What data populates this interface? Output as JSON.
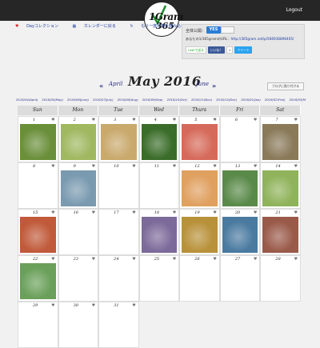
{
  "header": {
    "logout": "Logout"
  },
  "logo": {
    "top": "1Gram",
    "bottom": "365"
  },
  "links": {
    "day_collection": "Dayコレクション",
    "calendar": "カレンダーに戻る",
    "more": "もう一度写真を読み込む"
  },
  "panel": {
    "public_label": "全体公開：",
    "public_value": "YES",
    "url_label": "あなたの1/365gramのURL：",
    "url": "http://365gram.net/p/566936896405/",
    "line_btn": "LINEで送る",
    "fb_btn": "いいね！",
    "fb_count": "0",
    "tweet_btn": "ツイート"
  },
  "nav": {
    "prev": "April",
    "current": "May  2016",
    "next": "June",
    "share_button": "ブログに貼り付ける"
  },
  "months": [
    "2016/04(April)",
    "2016/05(May)",
    "2016/06(June)",
    "2016/07(July)",
    "2016/08(Aug)",
    "2016/09(Sep)",
    "2016/10(Oct)",
    "2016/11(Nov)",
    "2016/12(Dec)",
    "2016/01(Jan)",
    "2016/02(Feb)",
    "2016/03(Mar)"
  ],
  "calendar": {
    "weekdays": [
      "Sun",
      "Mon",
      "Tue",
      "Wed",
      "Thurs",
      "Fri",
      "Sat"
    ],
    "days": [
      "1",
      "2",
      "3",
      "4",
      "5",
      "6",
      "7",
      "8",
      "9",
      "10",
      "11",
      "12",
      "13",
      "14",
      "15",
      "16",
      "17",
      "18",
      "19",
      "20",
      "21",
      "22",
      "23",
      "24",
      "25",
      "26",
      "27",
      "28",
      "29",
      "30",
      "31"
    ],
    "photo_days": [
      "1",
      "2",
      "3",
      "4",
      "5",
      "7",
      "9",
      "12",
      "13",
      "14",
      "15",
      "18",
      "19",
      "20",
      "21",
      "22"
    ],
    "heart": "♥"
  },
  "colors": {
    "topbar": "#262626",
    "link": "#1a3aa0",
    "yes": "#2a7dd6"
  }
}
